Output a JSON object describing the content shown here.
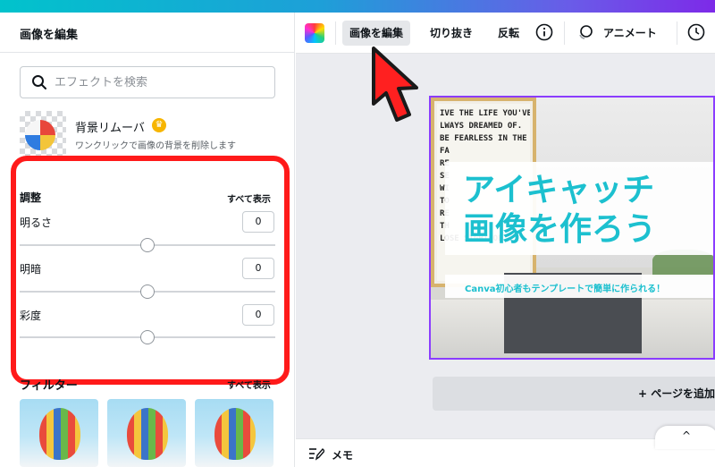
{
  "panel": {
    "title": "画像を編集",
    "search_placeholder": "エフェクトを検索",
    "bg_remover": {
      "name": "背景リムーバ",
      "desc": "ワンクリックで画像の背景を削除します",
      "crown_icon": "crown-icon"
    },
    "adjust": {
      "title": "調整",
      "see_all": "すべて表示",
      "items": [
        {
          "label": "明るさ",
          "value": "0"
        },
        {
          "label": "明暗",
          "value": "0"
        },
        {
          "label": "彩度",
          "value": "0"
        }
      ]
    },
    "filters": {
      "title": "フィルター",
      "see_all": "すべて表示"
    }
  },
  "toolbar": {
    "color_icon": "color-palette-icon",
    "edit_image": "画像を編集",
    "crop": "切り抜き",
    "flip": "反転",
    "info_icon": "info-icon",
    "animate": "アニメート",
    "timer_icon": "clock-icon"
  },
  "design": {
    "poster_text": "IVE THE LIFE YOU'VE\nLWAYS DREAMED OF.\nBE FEARLESS IN THE\nFA\nRE\nSE\nWI\nTO\nRE\nTH\nLOSE SIGHT OF",
    "headline_1": "アイキャッチ",
    "headline_2": "画像を作ろう",
    "subline": "Canva初心者もテンプレートで簡単に作られる！"
  },
  "add_page": "+ ページを追加",
  "bottom": {
    "memo": "メモ",
    "caret": "^"
  },
  "colors": {
    "accent_teal": "#1cc0cf",
    "selection_purple": "#8b3dff",
    "highlight_red": "#ff1a1a"
  }
}
